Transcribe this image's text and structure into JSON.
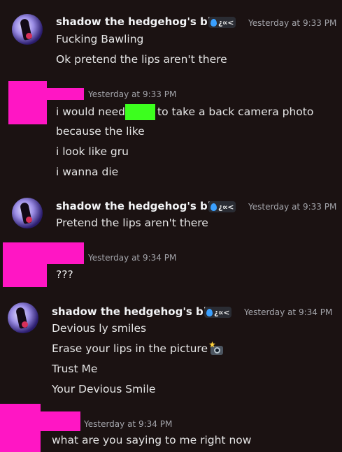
{
  "messages": [
    {
      "author": "shadow the hedgehog's bbg",
      "tag_text": "¿∝<",
      "time": "Yesterday at 9:33 PM",
      "lines": [
        "Fucking Bawling",
        "Ok pretend the lips aren't there"
      ]
    },
    {
      "author": "",
      "time": "Yesterday at 9:33 PM",
      "line1_before": "i would need",
      "line1_after": "to take a back camera photo",
      "lines": [
        "because the like",
        "i look like gru",
        "i wanna die"
      ]
    },
    {
      "author": "shadow the hedgehog's bbg",
      "tag_text": "¿∝<",
      "time": "Yesterday at 9:33 PM",
      "lines": [
        "Pretend the lips aren't there"
      ]
    },
    {
      "author": "",
      "time": "Yesterday at 9:34 PM",
      "lines": [
        "???"
      ]
    },
    {
      "author": "shadow the hedgehog's bbg",
      "tag_text": "¿∝<",
      "time": "Yesterday at 9:34 PM",
      "lines": [
        "Devious ly smiles",
        "Erase your lips in the picture",
        "Trust Me",
        "Your Devious Smile"
      ],
      "emoji": "camera-with-flash-icon"
    },
    {
      "author": "",
      "time": "Yesterday at 9:34 PM",
      "lines": [
        "what are you saying to me right now"
      ]
    }
  ],
  "colors": {
    "background": "#1b1212",
    "redaction_pink": "#ff16c4",
    "redaction_green": "#3cff1e",
    "timestamp": "#a3a4aa"
  }
}
